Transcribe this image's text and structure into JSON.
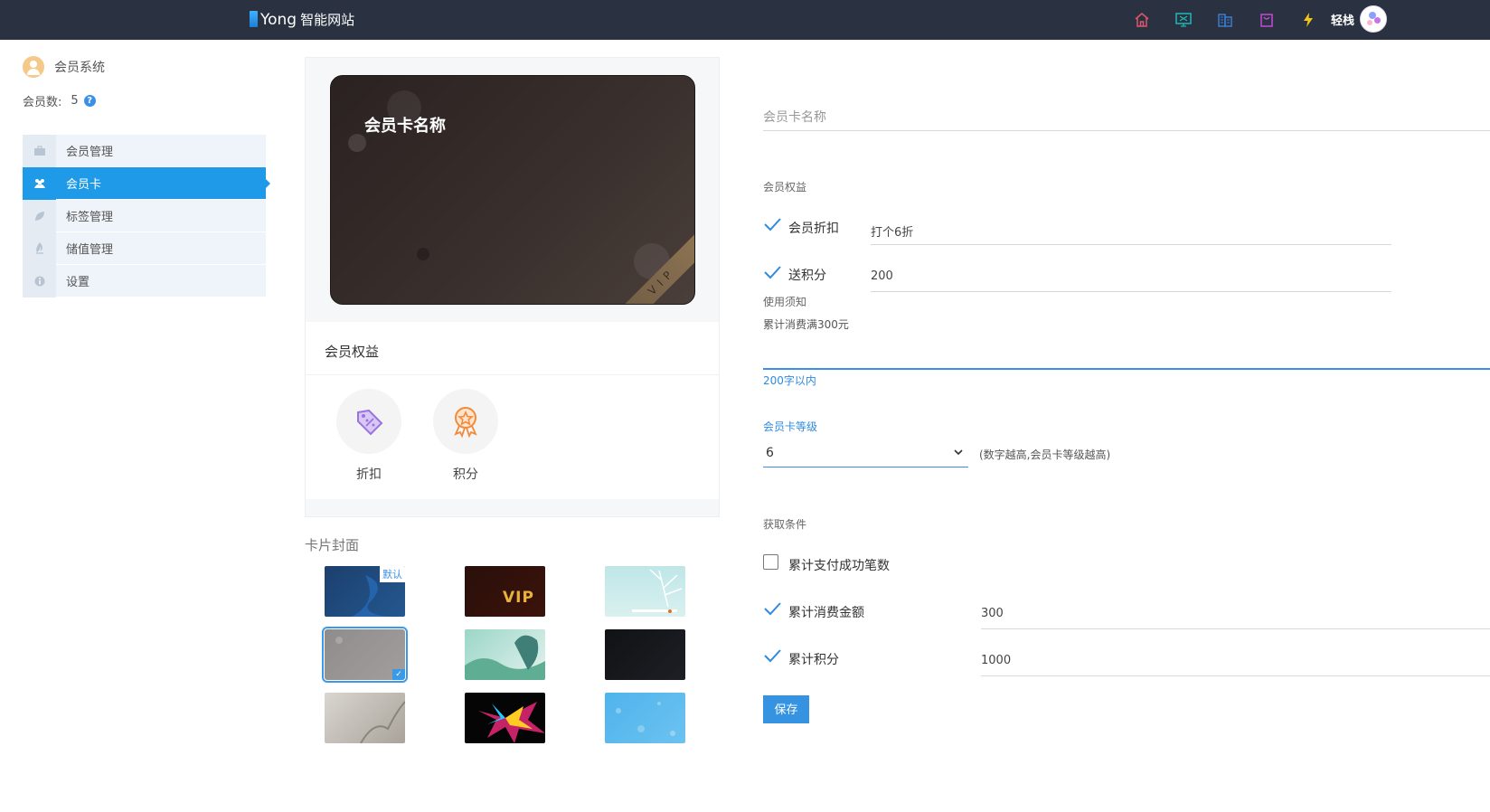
{
  "header": {
    "brand_i": "i",
    "brand_name": "Yong",
    "brand_suffix": "智能网站",
    "icons": [
      "home-icon",
      "monitor-icon",
      "building-icon",
      "bag-icon",
      "lightning-icon"
    ],
    "username": "轻栈"
  },
  "sidebar": {
    "system_title": "会员系统",
    "member_count_label": "会员数:",
    "member_count_value": "5",
    "help_glyph": "?",
    "items": [
      {
        "label": "会员管理",
        "icon": "briefcase-icon",
        "active": false
      },
      {
        "label": "会员卡",
        "icon": "users-icon",
        "active": true
      },
      {
        "label": "标签管理",
        "icon": "leaf-icon",
        "active": false
      },
      {
        "label": "储值管理",
        "icon": "flame-icon",
        "active": false
      },
      {
        "label": "设置",
        "icon": "info-icon",
        "active": false
      }
    ]
  },
  "preview": {
    "card_title": "会员卡名称",
    "card_ribbon": "VIP",
    "rights_title": "会员权益",
    "rights": [
      {
        "label": "折扣",
        "icon": "discount-tag-icon"
      },
      {
        "label": "积分",
        "icon": "medal-icon"
      }
    ]
  },
  "covers": {
    "title": "卡片封面",
    "default_tag": "默认",
    "items": [
      {
        "name": "cover-blue",
        "default": true,
        "selected": false
      },
      {
        "name": "cover-vip-dark",
        "default": false,
        "selected": false
      },
      {
        "name": "cover-teal-branches",
        "default": false,
        "selected": false
      },
      {
        "name": "cover-gray",
        "default": false,
        "selected": true
      },
      {
        "name": "cover-girl-flowers",
        "default": false,
        "selected": false
      },
      {
        "name": "cover-black",
        "default": false,
        "selected": false
      },
      {
        "name": "cover-silver-smoke",
        "default": false,
        "selected": false
      },
      {
        "name": "cover-color-burst",
        "default": false,
        "selected": false
      },
      {
        "name": "cover-blue-pattern",
        "default": false,
        "selected": false
      }
    ],
    "vip_cover_text": "VIP"
  },
  "form": {
    "card_name_placeholder": "会员卡名称",
    "rights_label": "会员权益",
    "discount_label": "会员折扣",
    "discount_value": "打个6折",
    "points_label": "送积分",
    "points_value": "200",
    "notice_label": "使用须知",
    "notice_value": "累计消费满300元",
    "notice_hint": "200字以内",
    "level_label": "会员卡等级",
    "level_value": "6",
    "level_hint": "(数字越高,会员卡等级越高)",
    "condition_label": "获取条件",
    "cond_tx_label": "累计支付成功笔数",
    "cond_tx_checked": false,
    "cond_amount_label": "累计消费金额",
    "cond_amount_value": "300",
    "cond_amount_checked": true,
    "cond_points_label": "累计积分",
    "cond_points_value": "1000",
    "cond_points_checked": true,
    "save_label": "保存"
  },
  "colors": {
    "topbar": "#2a3140",
    "accent": "#1e9ae9",
    "save_button": "#3593e2"
  }
}
